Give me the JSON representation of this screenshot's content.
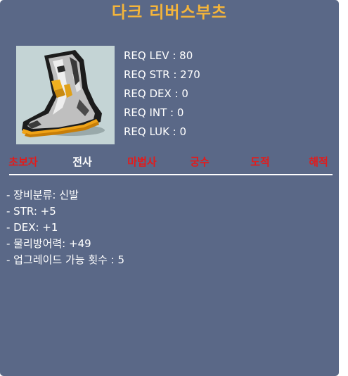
{
  "item": {
    "name": "다크 리버스부츠",
    "icon": "boots-icon",
    "colors": {
      "panel": "#5a6887",
      "title": "#f5b53a",
      "text": "#ffffff",
      "job_inactive": "#e31b1b",
      "icon_bg": "#c4d4d5"
    }
  },
  "requirements": [
    "REQ LEV : 80",
    "REQ STR : 270",
    "REQ DEX : 0",
    "REQ INT : 0",
    "REQ LUK : 0"
  ],
  "jobs": [
    {
      "label": "초보자",
      "state": "inactive"
    },
    {
      "label": "전사",
      "state": "active"
    },
    {
      "label": "마법사",
      "state": "inactive"
    },
    {
      "label": "궁수",
      "state": "inactive"
    },
    {
      "label": "도적",
      "state": "inactive"
    },
    {
      "label": "해적",
      "state": "inactive"
    }
  ],
  "stats": [
    "- 장비분류: 신발",
    "- STR: +5",
    "- DEX: +1",
    "- 물리방어력: +49",
    "- 업그레이드 가능 횟수 : 5"
  ]
}
